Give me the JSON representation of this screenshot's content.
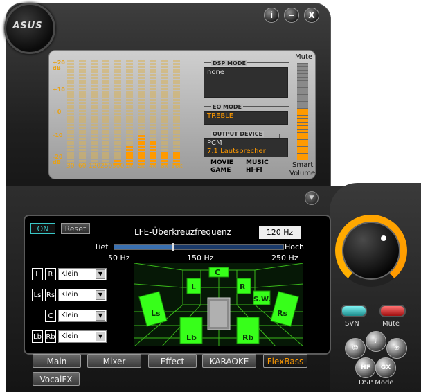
{
  "app": {
    "logo_text": "ASUS"
  },
  "title_buttons": {
    "info": "i",
    "minimize": "−",
    "close": "X"
  },
  "equalizer": {
    "db_labels": [
      "+20 dB",
      "+10",
      "+0",
      "-10",
      "-20 dB"
    ],
    "bands": [
      {
        "label": "30",
        "level": 0
      },
      {
        "label": "60",
        "level": 0
      },
      {
        "label": "120",
        "level": 0
      },
      {
        "label": "250",
        "level": 0
      },
      {
        "label": "500",
        "level": 2
      },
      {
        "label": "1k",
        "level": 7
      },
      {
        "label": "2k",
        "level": 11
      },
      {
        "label": "4k",
        "level": 9
      },
      {
        "label": "8k",
        "level": 5
      },
      {
        "label": "16k",
        "level": 5
      }
    ],
    "total_segments": 38
  },
  "dsp_mode": {
    "title": "DSP MODE",
    "value": "none"
  },
  "eq_mode": {
    "title": "EQ MODE",
    "value": "TREBLE"
  },
  "output_device": {
    "title": "OUTPUT DEVICE",
    "line1": "PCM",
    "line2": "7.1 Lautsprecher"
  },
  "mode_labels": {
    "movie": "MOVIE",
    "music": "MUSIC",
    "game": "GAME",
    "hifi": "Hi-Fi"
  },
  "volume": {
    "mute_label": "Mute",
    "smart_label": "Smart",
    "volume_label": "Volume",
    "level": 0.55
  },
  "flexbass": {
    "on_label": "ON",
    "reset_label": "Reset",
    "crossover_title": "LFE-Überkreuzfrequenz",
    "crossover_value": "120 Hz",
    "slider_low": "Tief",
    "slider_high": "Hoch",
    "slider_value": 0.35,
    "scale": [
      "50 Hz",
      "150 Hz",
      "250 Hz"
    ],
    "speakers": [
      {
        "a": "L",
        "b": "R",
        "size": "Klein"
      },
      {
        "a": "Ls",
        "b": "Rs",
        "size": "Klein"
      },
      {
        "a": "",
        "b": "C",
        "size": "Klein"
      },
      {
        "a": "Lb",
        "b": "Rb",
        "size": "Klein"
      }
    ],
    "room_labels": {
      "c": "C",
      "l": "L",
      "r": "R",
      "sw": "S.W.",
      "ls": "Ls",
      "rs": "Rs",
      "lb": "Lb",
      "rb": "Rb"
    }
  },
  "tabs": [
    "Main",
    "Mixer",
    "Effect",
    "KARAOKE",
    "FlexBass",
    "VocalFX"
  ],
  "active_tab": "FlexBass",
  "right": {
    "svn_label": "SVN",
    "mute_label": "Mute",
    "dsp_mode_label": "DSP Mode",
    "hf_label": "HF",
    "gx_label": "GX"
  },
  "colors": {
    "accent": "#ff9a00",
    "speaker_green": "#37ff1a",
    "svn_teal": "#39c6c6",
    "mute_red": "#e03030"
  }
}
